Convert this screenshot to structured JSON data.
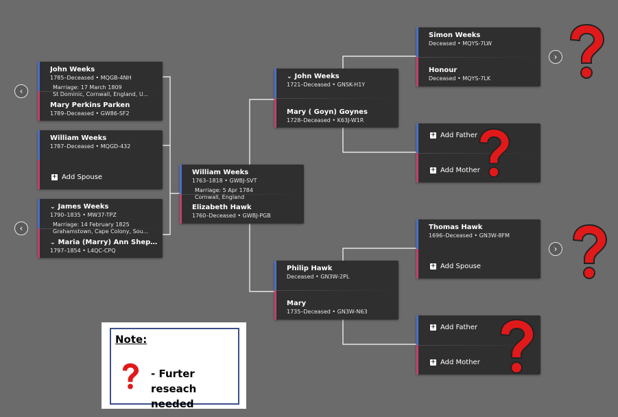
{
  "colors": {
    "background": "#6b6b6b",
    "card": "#2f2f2f",
    "father_accent": "#4a6fc7",
    "mother_accent": "#c1416b",
    "question_mark": "#e0191b",
    "note_border": "#3b4f8a"
  },
  "children": [
    {
      "husband": {
        "name": "John Weeks",
        "meta": "1785–Deceased • MQGB-4NH"
      },
      "marriage": [
        "Marriage: 17 March 1809",
        "St Dominic, Cornwall, England, U..."
      ],
      "wife": {
        "name": "Mary Perkins Parken",
        "meta": "1789–Deceased • GW86-SF2"
      }
    },
    {
      "husband": {
        "name": "William Weeks",
        "meta": "1787–Deceased • MQGD-432"
      },
      "add_spouse": "Add Spouse"
    },
    {
      "husband": {
        "name": "James Weeks",
        "meta": "1790–1835 • MW37-TPZ"
      },
      "marriage": [
        "Marriage: 14 February 1825",
        "Grahamstown, Cape Colony, Sou..."
      ],
      "wife": {
        "name": "Maria (Marry) Ann Sheppers...",
        "meta": "1797–1854 • L4QC-CPQ"
      }
    }
  ],
  "focus": {
    "husband": {
      "name": "William Weeks",
      "meta": "1763–1818 • GWBJ-SVT"
    },
    "marriage": [
      "Marriage: 5 Apr 1784",
      "Cornwall, England"
    ],
    "wife": {
      "name": "Elizabeth Hawk",
      "meta": "1760–Deceased • GWBJ-PGB"
    }
  },
  "parents": [
    {
      "husband": {
        "name": "John Weeks",
        "meta": "1721–Deceased • GNSK-H1Y"
      },
      "wife": {
        "name": "Mary ( Goyn) Goynes",
        "meta": "1728–Deceased • K63J-W1R"
      }
    },
    {
      "husband": {
        "name": "Philip Hawk",
        "meta": "Deceased • GN3W-2PL"
      },
      "wife": {
        "name": "Mary",
        "meta": "1735–Deceased • GN3W-N63"
      }
    }
  ],
  "grandparents": [
    {
      "husband": {
        "name": "Simon Weeks",
        "meta": "Deceased • MQYS-7LW"
      },
      "wife": {
        "name": "Honour",
        "meta": "Deceased • MQYS-7LK"
      }
    },
    {
      "add_father": "Add Father",
      "add_mother": "Add Mother"
    },
    {
      "husband": {
        "name": "Thomas Hawk",
        "meta": "1696–Deceased • GN3W-8FM"
      },
      "add_spouse": "Add Spouse"
    },
    {
      "add_father": "Add Father",
      "add_mother": "Add Mother"
    }
  ],
  "icons": {
    "prev": "chevron-left-icon",
    "next": "chevron-right-icon",
    "expand": "chevron-down-icon",
    "add": "plus-box-icon",
    "unknown": "question-mark-icon"
  },
  "glyphs": {
    "prev": "‹",
    "next": "›",
    "expand": "⌄",
    "plus": "+"
  },
  "note": {
    "title": "Note:",
    "text": "- Furter reseach needed"
  }
}
